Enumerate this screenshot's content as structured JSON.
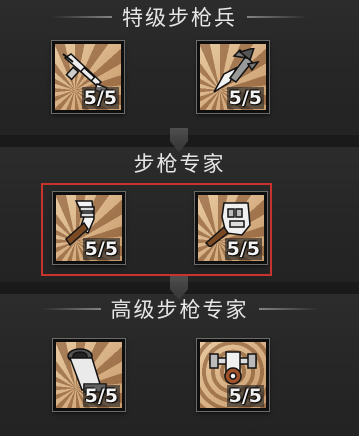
{
  "tiers": [
    {
      "title": "特级步枪兵",
      "skills": [
        {
          "icon": "rifle-weapon-icon",
          "progress": "5/5",
          "value": 5,
          "max": 5
        },
        {
          "icon": "spiked-ammo-icon",
          "progress": "5/5",
          "value": 5,
          "max": 5
        }
      ]
    },
    {
      "title": "步枪专家",
      "selected": true,
      "skills": [
        {
          "icon": "leg-bandage-icon",
          "progress": "5/5",
          "value": 5,
          "max": 5
        },
        {
          "icon": "armored-hand-icon",
          "progress": "5/5",
          "value": 5,
          "max": 5
        }
      ]
    },
    {
      "title": "高级步枪专家",
      "skills": [
        {
          "icon": "mortar-barrel-icon",
          "progress": "5/5",
          "value": 5,
          "max": 5
        },
        {
          "icon": "crosshair-drone-icon",
          "progress": "5/5",
          "value": 5,
          "max": 5
        }
      ]
    }
  ],
  "colors": {
    "selection": "#c8342c",
    "icon_bg": "#dcb68a",
    "panel": "#262626"
  }
}
